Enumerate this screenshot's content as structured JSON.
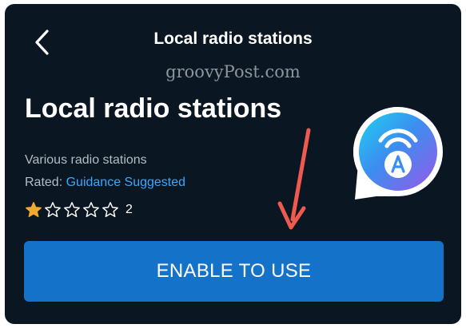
{
  "header": {
    "title": "Local radio stations"
  },
  "watermark": "groovyPost.com",
  "skill": {
    "title": "Local radio stations",
    "description": "Various radio stations",
    "rated_label": "Rated: ",
    "rated_value": "Guidance Suggested",
    "rating": {
      "stars": 1,
      "max_stars": 5,
      "count": "2"
    }
  },
  "cta": {
    "label": "ENABLE TO USE"
  },
  "icons": {
    "back": "chevron-left-icon",
    "skill": "alexa-skill-icon",
    "annotation": "red-arrow-icon"
  },
  "colors": {
    "background": "#0a1621",
    "accent": "#1473c9",
    "link": "#39a8ff",
    "star": "#f0a830",
    "arrow": "#ef5a4e"
  }
}
